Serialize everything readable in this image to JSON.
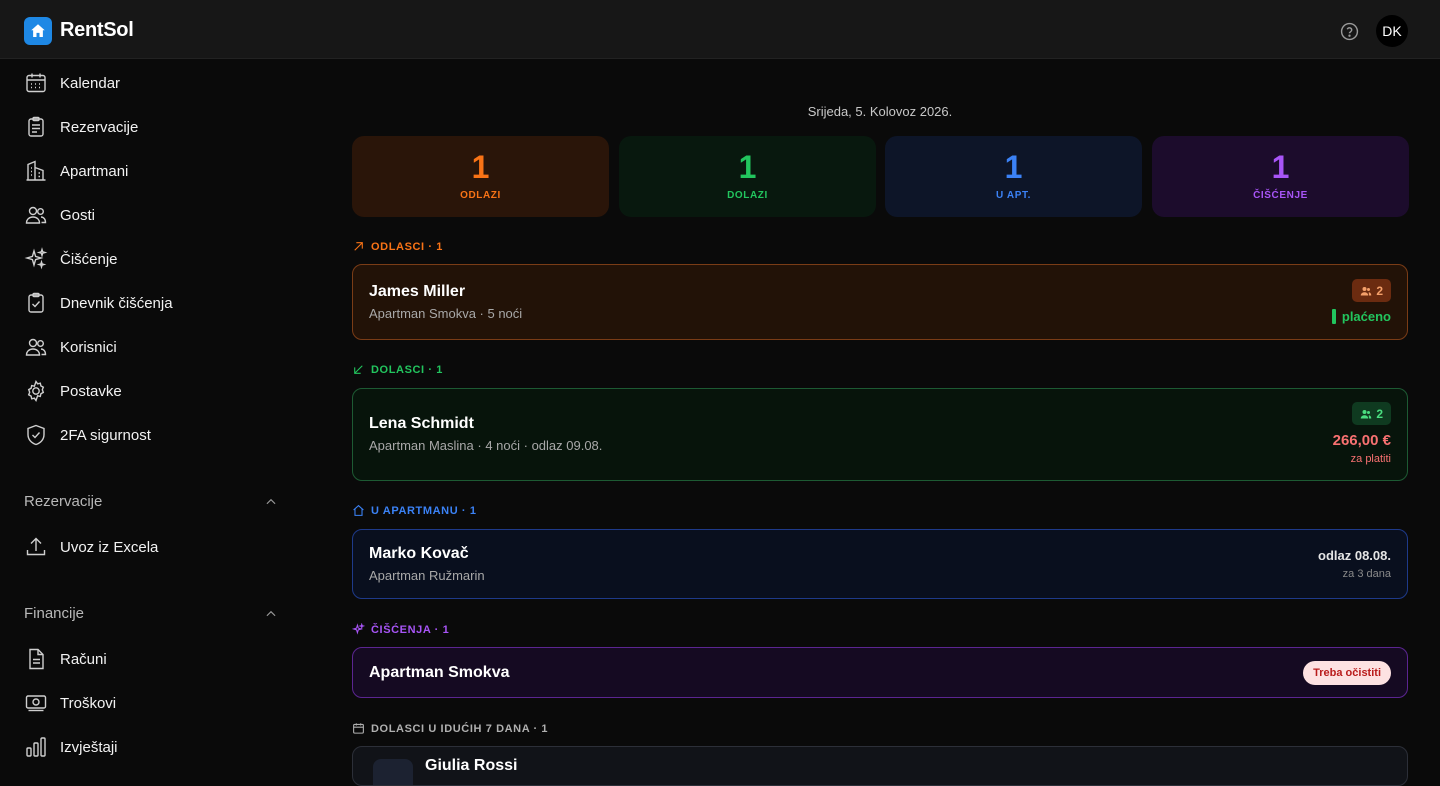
{
  "app": {
    "brand": "RentSol",
    "avatar_initials": "DK"
  },
  "sidebar": {
    "items": [
      {
        "label": "Kalendar",
        "icon": "calendar-icon"
      },
      {
        "label": "Rezervacije",
        "icon": "clipboard-icon"
      },
      {
        "label": "Apartmani",
        "icon": "building-icon"
      },
      {
        "label": "Gosti",
        "icon": "users-icon"
      },
      {
        "label": "Čišćenje",
        "icon": "sparkles-icon"
      },
      {
        "label": "Dnevnik čišćenja",
        "icon": "clipboard-check-icon"
      },
      {
        "label": "Korisnici",
        "icon": "users-icon"
      },
      {
        "label": "Postavke",
        "icon": "gear-icon"
      },
      {
        "label": "2FA sigurnost",
        "icon": "shield-check-icon"
      }
    ],
    "sections": [
      {
        "title": "Rezervacije",
        "items": [
          {
            "label": "Uvoz iz Excela",
            "icon": "upload-icon"
          }
        ]
      },
      {
        "title": "Financije",
        "items": [
          {
            "label": "Računi",
            "icon": "document-icon"
          },
          {
            "label": "Troškovi",
            "icon": "banknote-icon"
          },
          {
            "label": "Izvještaji",
            "icon": "bar-chart-icon"
          }
        ]
      }
    ]
  },
  "main": {
    "date": "Srijeda, 5. Kolovoz 2026.",
    "stats": [
      {
        "value": "1",
        "label": "ODLAZI",
        "color": "#f97316"
      },
      {
        "value": "1",
        "label": "DOLAZI",
        "color": "#22c55e"
      },
      {
        "value": "1",
        "label": "U APT.",
        "color": "#3b82f6"
      },
      {
        "value": "1",
        "label": "ČIŠĆENJE",
        "color": "#a855f7"
      }
    ],
    "departures": {
      "title": "ODLASCI · 1",
      "card": {
        "name": "James Miller",
        "sub": "Apartman Smokva · 5 noći",
        "guests": "2",
        "status": "plaćeno"
      }
    },
    "arrivals": {
      "title": "DOLASCI · 1",
      "card": {
        "name": "Lena Schmidt",
        "sub": "Apartman Maslina · 4 noći · odlaz 09.08.",
        "guests": "2",
        "amount": "266,00 €",
        "amount_note": "za platiti"
      }
    },
    "in_apartment": {
      "title": "U APARTMANU · 1",
      "card": {
        "name": "Marko Kovač",
        "sub": "Apartman Ružmarin",
        "checkout": "odlaz 08.08.",
        "checkout_note": "za 3 dana"
      }
    },
    "cleaning": {
      "title": "ČIŠĆENJA · 1",
      "card": {
        "name": "Apartman Smokva",
        "badge": "Treba očistiti"
      }
    },
    "upcoming": {
      "title": "DOLASCI U IDUĆIH 7 DANA · 1",
      "card": {
        "name": "Giulia Rossi"
      }
    }
  }
}
